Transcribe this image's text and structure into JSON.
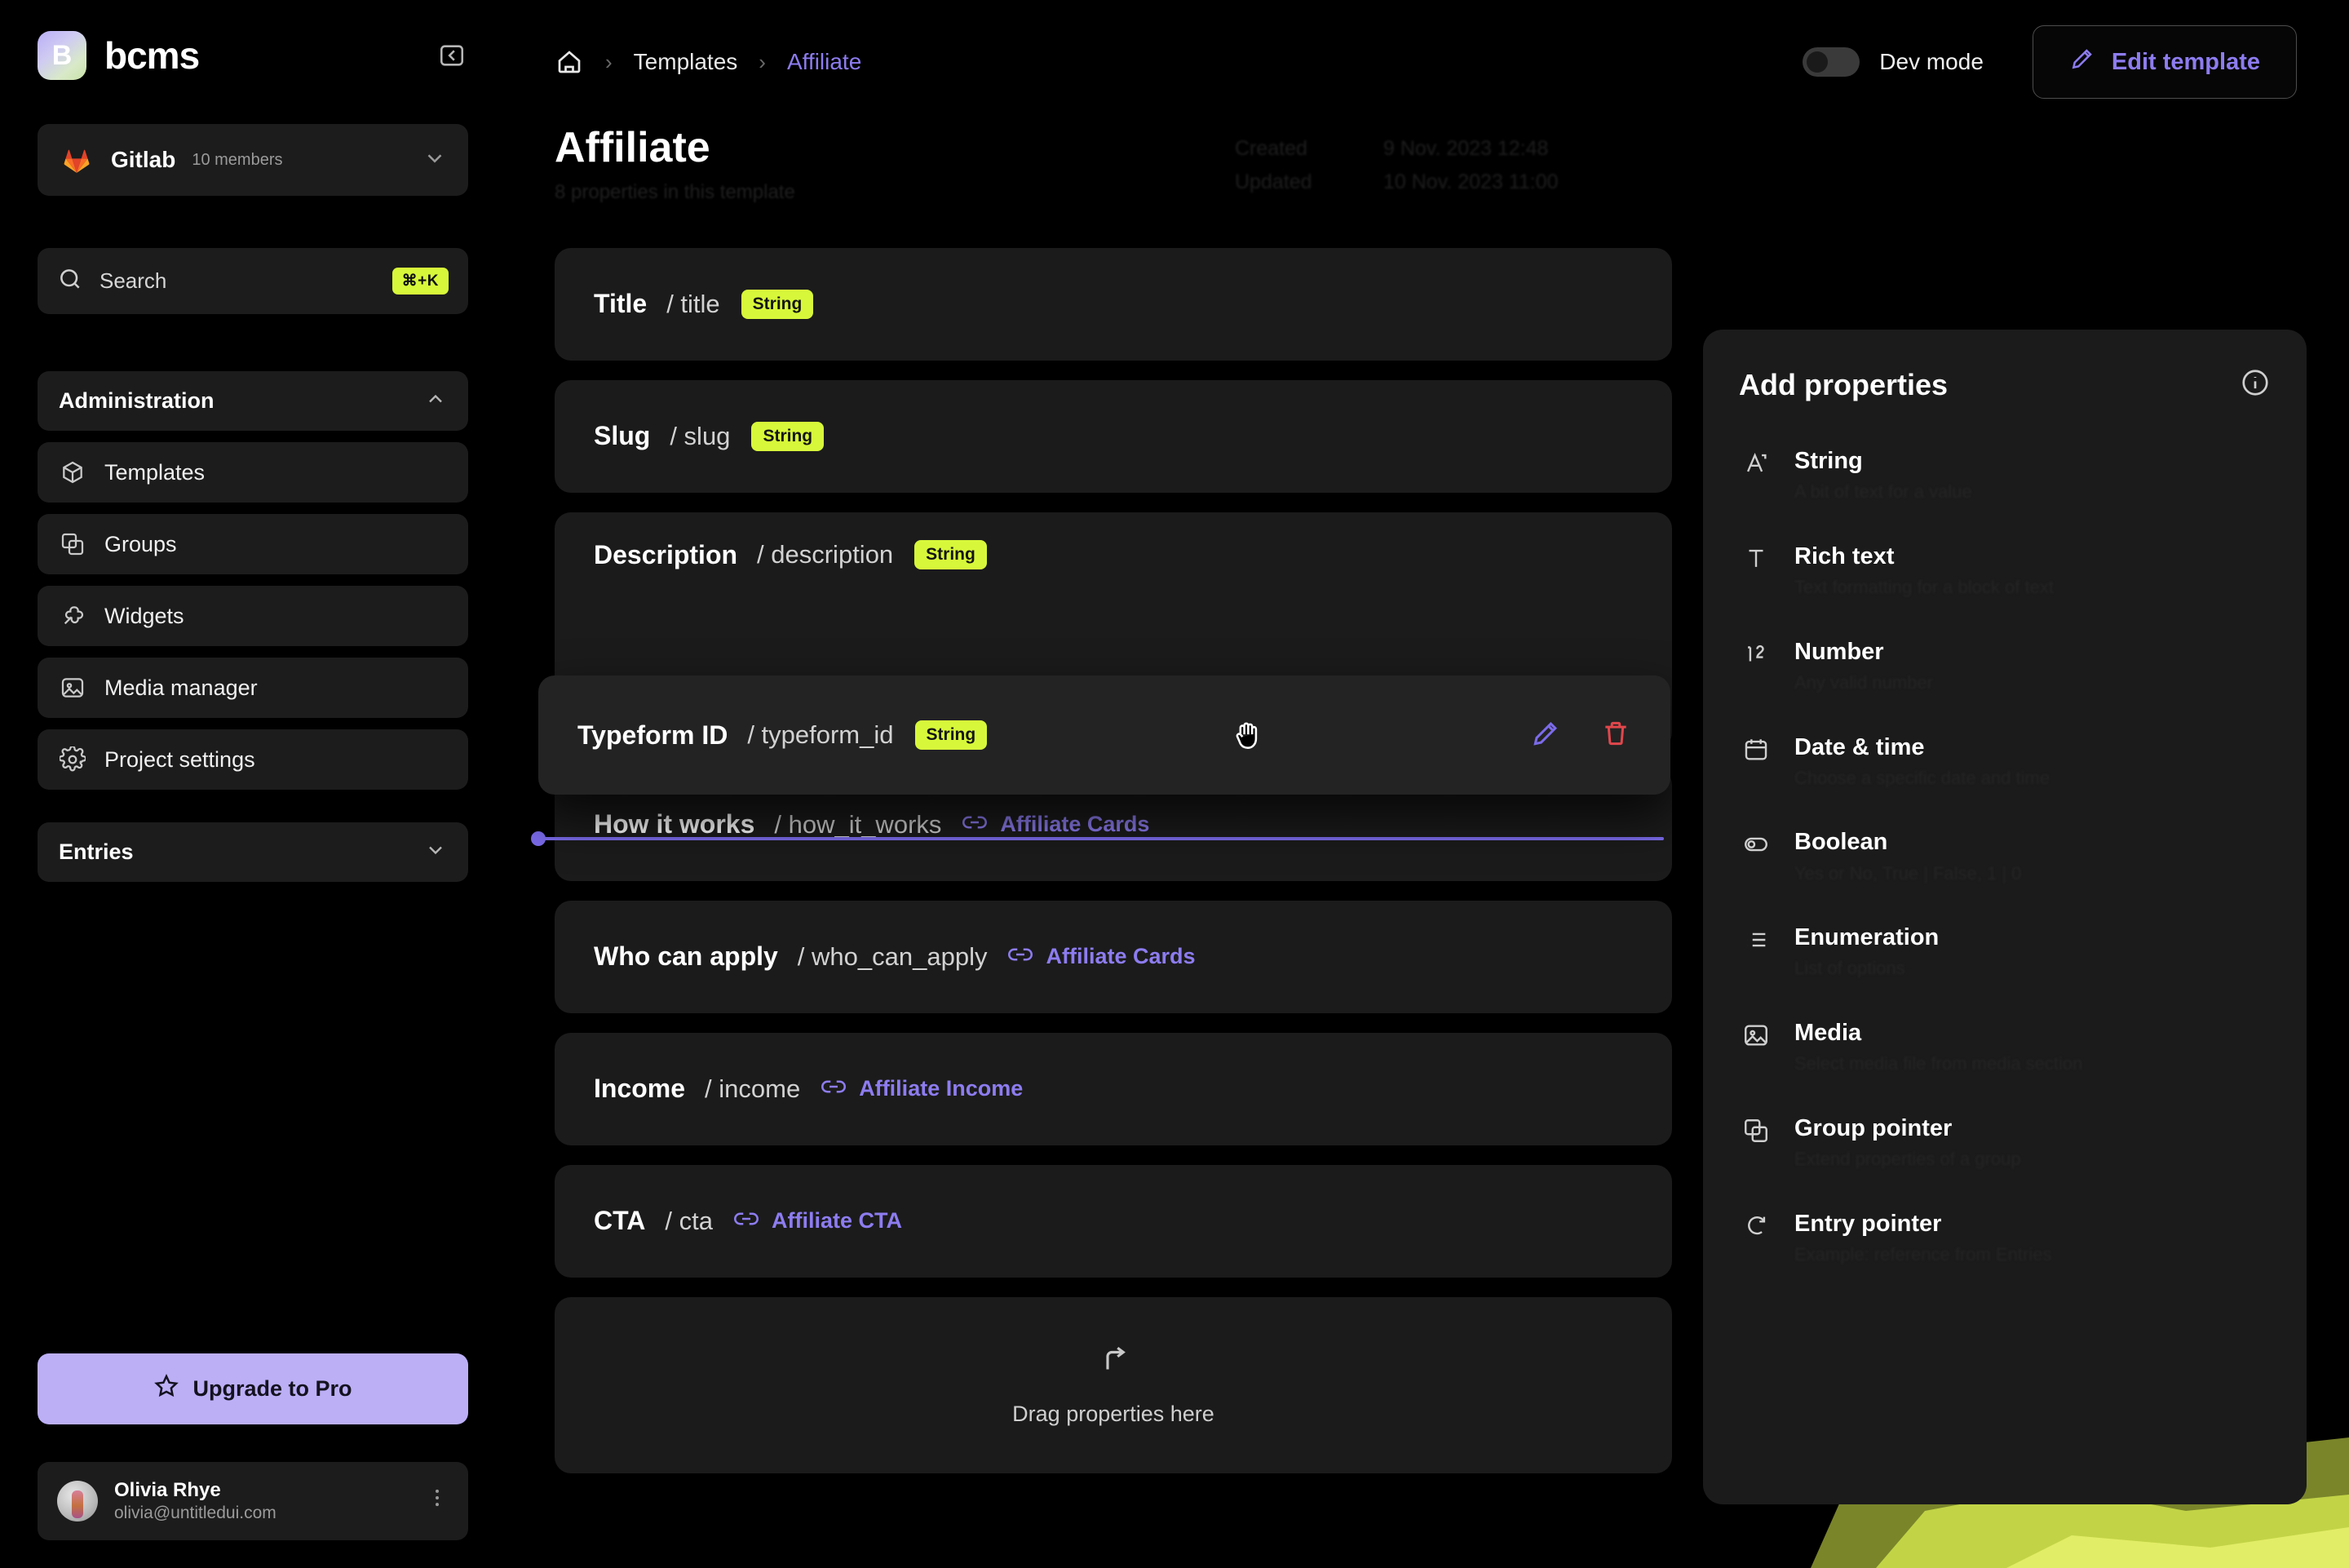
{
  "sidebar": {
    "brand": {
      "name": "bcms",
      "logo_letter": "B",
      "collapse_icon": "collapse-panel-icon"
    },
    "org": {
      "name": "Gitlab",
      "members": "10 members"
    },
    "search": {
      "placeholder": "Search",
      "shortcut": "⌘+K"
    },
    "section": {
      "label": "Administration"
    },
    "items": [
      {
        "label": "Templates",
        "icon": "cube-icon"
      },
      {
        "label": "Groups",
        "icon": "layers-icon"
      },
      {
        "label": "Widgets",
        "icon": "puzzle-icon"
      },
      {
        "label": "Media manager",
        "icon": "image-icon"
      },
      {
        "label": "Project settings",
        "icon": "gear-icon"
      }
    ],
    "entries": {
      "label": "Entries"
    },
    "upgrade": {
      "label": "Upgrade to Pro",
      "icon": "star-icon"
    },
    "user": {
      "name": "Olivia Rhye",
      "email": "olivia@untitledui.com"
    }
  },
  "topbar": {
    "breadcrumb": [
      {
        "label": "home",
        "icon": "home-icon"
      },
      {
        "label": "Templates"
      },
      {
        "label": "Affiliate"
      }
    ],
    "dev_mode": {
      "label": "Dev mode",
      "state": "off"
    },
    "edit_template": {
      "label": "Edit template",
      "icon": "pencil-icon"
    }
  },
  "page": {
    "title": "Affiliate",
    "subtitle": "8 properties in this template",
    "meta": [
      {
        "key": "Created",
        "value": "9 Nov. 2023 12:48"
      },
      {
        "key": "Updated",
        "value": "10 Nov. 2023 11:00"
      }
    ]
  },
  "properties": [
    {
      "name": "Title",
      "slug": "/ title",
      "type": "String",
      "kind": "string"
    },
    {
      "name": "Slug",
      "slug": "/ slug",
      "type": "String",
      "kind": "string"
    },
    {
      "name": "Description",
      "slug": "/ description",
      "type": "String",
      "kind": "string"
    },
    {
      "name": "How it works",
      "slug": "/ how_it_works",
      "type": "Affiliate Cards",
      "kind": "ref"
    },
    {
      "name": "Who can apply",
      "slug": "/ who_can_apply",
      "type": "Affiliate Cards",
      "kind": "ref"
    },
    {
      "name": "Income",
      "slug": "/ income",
      "type": "Affiliate Income",
      "kind": "ref"
    },
    {
      "name": "CTA",
      "slug": "/ cta",
      "type": "Affiliate CTA",
      "kind": "ref"
    }
  ],
  "dragging": {
    "name": "Typeform ID",
    "slug": "/ typeform_id",
    "type": "String",
    "cursor_icon": "grabbing-hand-icon",
    "edit_icon": "pencil-icon",
    "delete_icon": "trash-icon"
  },
  "dropzone": {
    "label": "Drag properties here",
    "icon": "arrow-drop-icon"
  },
  "add_properties": {
    "title": "Add properties",
    "info_icon": "info-icon",
    "items": [
      {
        "label": "String",
        "desc": "A bit of text for a value",
        "icon": "string-icon"
      },
      {
        "label": "Rich text",
        "desc": "Text formatting for a block of text",
        "icon": "rich-text-icon"
      },
      {
        "label": "Number",
        "desc": "Any valid number",
        "icon": "number-icon"
      },
      {
        "label": "Date & time",
        "desc": "Choose a specific date and time",
        "icon": "calendar-icon"
      },
      {
        "label": "Boolean",
        "desc": "Yes or No, True | False, 1 | 0",
        "icon": "boolean-icon"
      },
      {
        "label": "Enumeration",
        "desc": "List of options",
        "icon": "list-icon"
      },
      {
        "label": "Media",
        "desc": "Select media file from media section",
        "icon": "media-icon"
      },
      {
        "label": "Group pointer",
        "desc": "Extend properties of a group",
        "icon": "group-pointer-icon"
      },
      {
        "label": "Entry pointer",
        "desc": "Example: reference from Entries",
        "icon": "entry-pointer-icon"
      }
    ]
  },
  "colors": {
    "accent": "#8d7cf0",
    "badge": "#d7f83a",
    "upgrade": "#bcaff6",
    "danger": "#e0474c",
    "panel": "#1b1b1b",
    "background": "#000000"
  }
}
